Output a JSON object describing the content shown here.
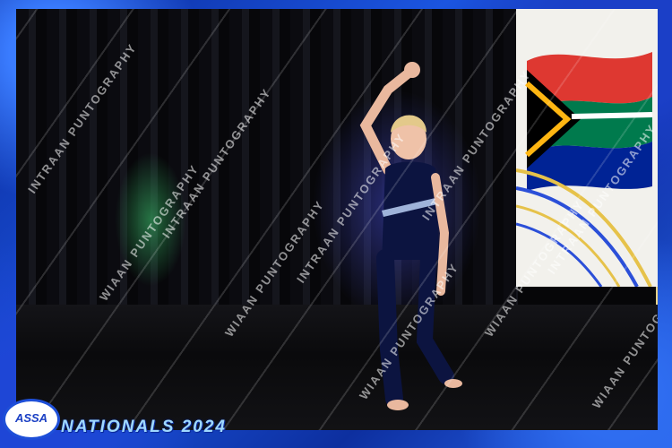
{
  "photo": {
    "description_colors": {
      "background_frame": "#1b55e0",
      "gold_edge": "#e7d38a",
      "leotard": "#0c1440",
      "curtain": "#0b0b10"
    }
  },
  "watermark": {
    "text": "INTRAAN PUNTOGRAPHY",
    "text_alt": "WIAAN PUNTOGRAPHY"
  },
  "logo": {
    "text": "ASSA"
  },
  "event": {
    "label": "NATIONALS 2024"
  }
}
